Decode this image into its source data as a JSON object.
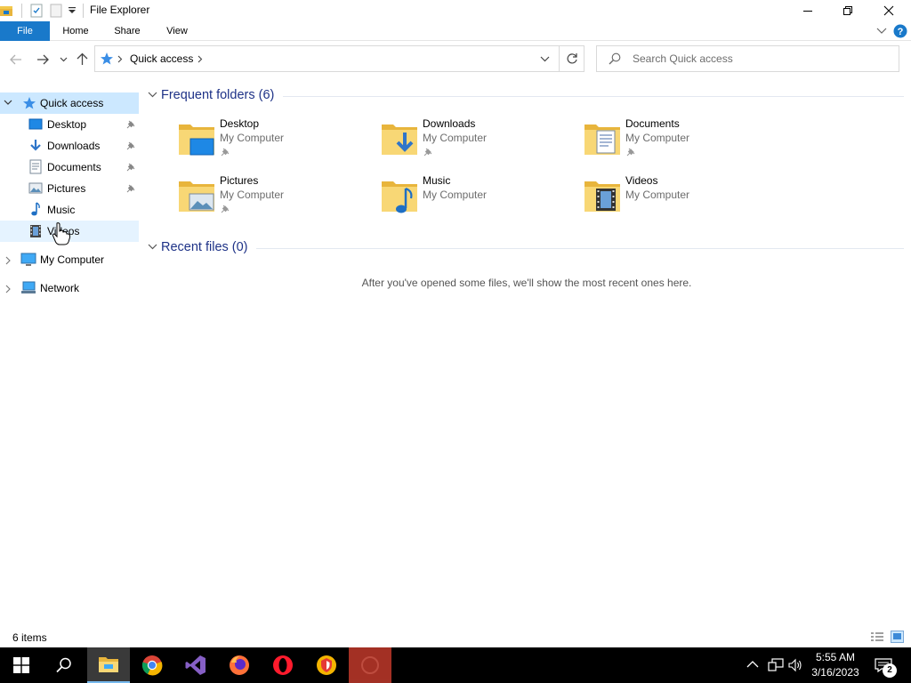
{
  "window": {
    "title": "File Explorer"
  },
  "ribbon": {
    "tabs": [
      "File",
      "Home",
      "Share",
      "View"
    ]
  },
  "address": {
    "location": "Quick access",
    "search_placeholder": "Search Quick access"
  },
  "nav": {
    "quick_access": "Quick access",
    "items": [
      "Desktop",
      "Downloads",
      "Documents",
      "Pictures",
      "Music",
      "Videos"
    ],
    "my_computer": "My Computer",
    "network": "Network"
  },
  "content": {
    "frequent_header": "Frequent folders (6)",
    "folders": [
      {
        "name": "Desktop",
        "location": "My Computer"
      },
      {
        "name": "Downloads",
        "location": "My Computer"
      },
      {
        "name": "Documents",
        "location": "My Computer"
      },
      {
        "name": "Pictures",
        "location": "My Computer"
      },
      {
        "name": "Music",
        "location": "My Computer"
      },
      {
        "name": "Videos",
        "location": "My Computer"
      }
    ],
    "recent_header": "Recent files (0)",
    "recent_empty": "After you've opened some files, we'll show the most recent ones here."
  },
  "status": {
    "items": "6 items"
  },
  "taskbar": {
    "time": "5:55 AM",
    "date": "3/16/2023",
    "notifications": "2"
  },
  "colors": {
    "accent": "#1979ca",
    "header_blue": "#1e3287",
    "selected_bg": "#cce8ff",
    "hover_bg": "#e5f3ff",
    "folder_yellow": "#f8d775"
  }
}
